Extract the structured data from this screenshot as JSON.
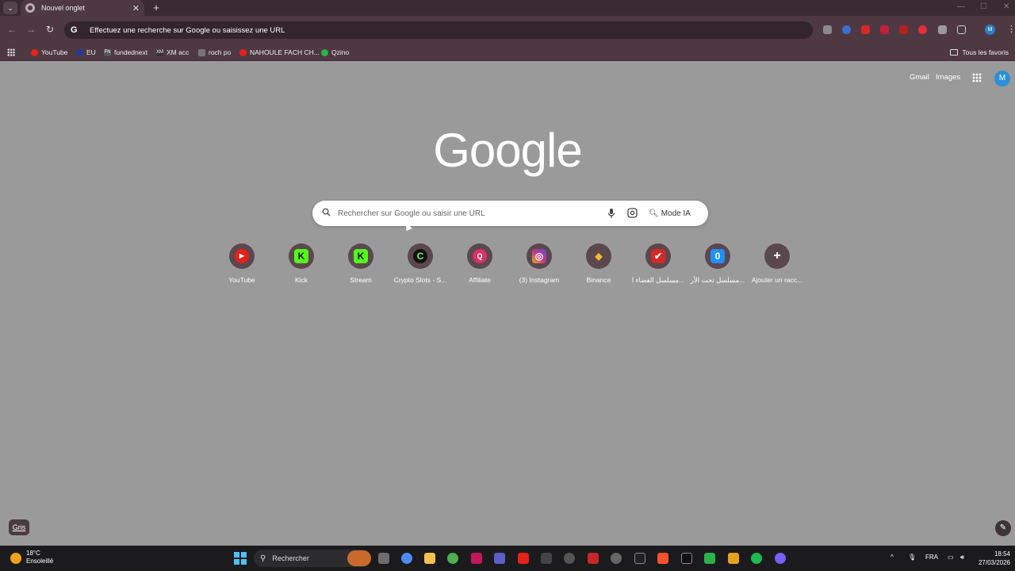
{
  "browser": {
    "tab_title": "Nouvel onglet",
    "tab_close": "✕",
    "new_tab": "+",
    "omnibox_text": "Effectuez une recherche sur Google ou saisissez une URL",
    "profile_initial": "M",
    "accent_color": "#4e3942"
  },
  "bookmarks": [
    {
      "label": "YouTube",
      "color": "#e62117"
    },
    {
      "label": "EU",
      "color": "#1f3c9a"
    },
    {
      "label": "fundednext",
      "color": "#555555"
    },
    {
      "label": "XM acc",
      "color": "#333333"
    },
    {
      "label": "roch po",
      "color": "#777777"
    },
    {
      "label": "NAHOULE FACH CH...",
      "color": "#e62117"
    },
    {
      "label": "Qzino",
      "color": "#2bb34a"
    }
  ],
  "all_bookmarks": "Tous les favoris",
  "ntp": {
    "links": {
      "gmail": "Gmail",
      "images": "Images"
    },
    "avatar": "M",
    "logo": "Google",
    "search_placeholder": "Rechercher sur Google ou saisir une URL",
    "mode_ia": "Mode IA",
    "shortcuts": [
      {
        "label": "YouTube",
        "glyph": "▶",
        "color": "#e62117"
      },
      {
        "label": "Kick",
        "glyph": "K",
        "color": "#53fc18"
      },
      {
        "label": "Stream",
        "glyph": "K",
        "color": "#53fc18"
      },
      {
        "label": "Crypto Slots - S...",
        "glyph": "C",
        "color": "#111111"
      },
      {
        "label": "Affiliate",
        "glyph": "Q",
        "color": "#d6336c"
      },
      {
        "label": "(3) Instagram",
        "glyph": "◎",
        "color": "#c13584"
      },
      {
        "label": "Binance",
        "glyph": "◆",
        "color": "#f3ba2f"
      },
      {
        "label": "مسلسل القضاء ا...",
        "glyph": "✔",
        "color": "#d62828"
      },
      {
        "label": "مسلسل تحت الأر...",
        "glyph": "0",
        "color": "#1e90ff"
      },
      {
        "label": "Ajouter un racc...",
        "glyph": "+",
        "color": "#5b484e"
      }
    ],
    "theme_label": "Gris",
    "edit_icon": "✎"
  },
  "taskbar": {
    "temperature": "18°C",
    "condition": "Ensoleillé",
    "search_label": "Rechercher",
    "language": "FRA",
    "time": "18:54",
    "date": "27/03/2026"
  }
}
